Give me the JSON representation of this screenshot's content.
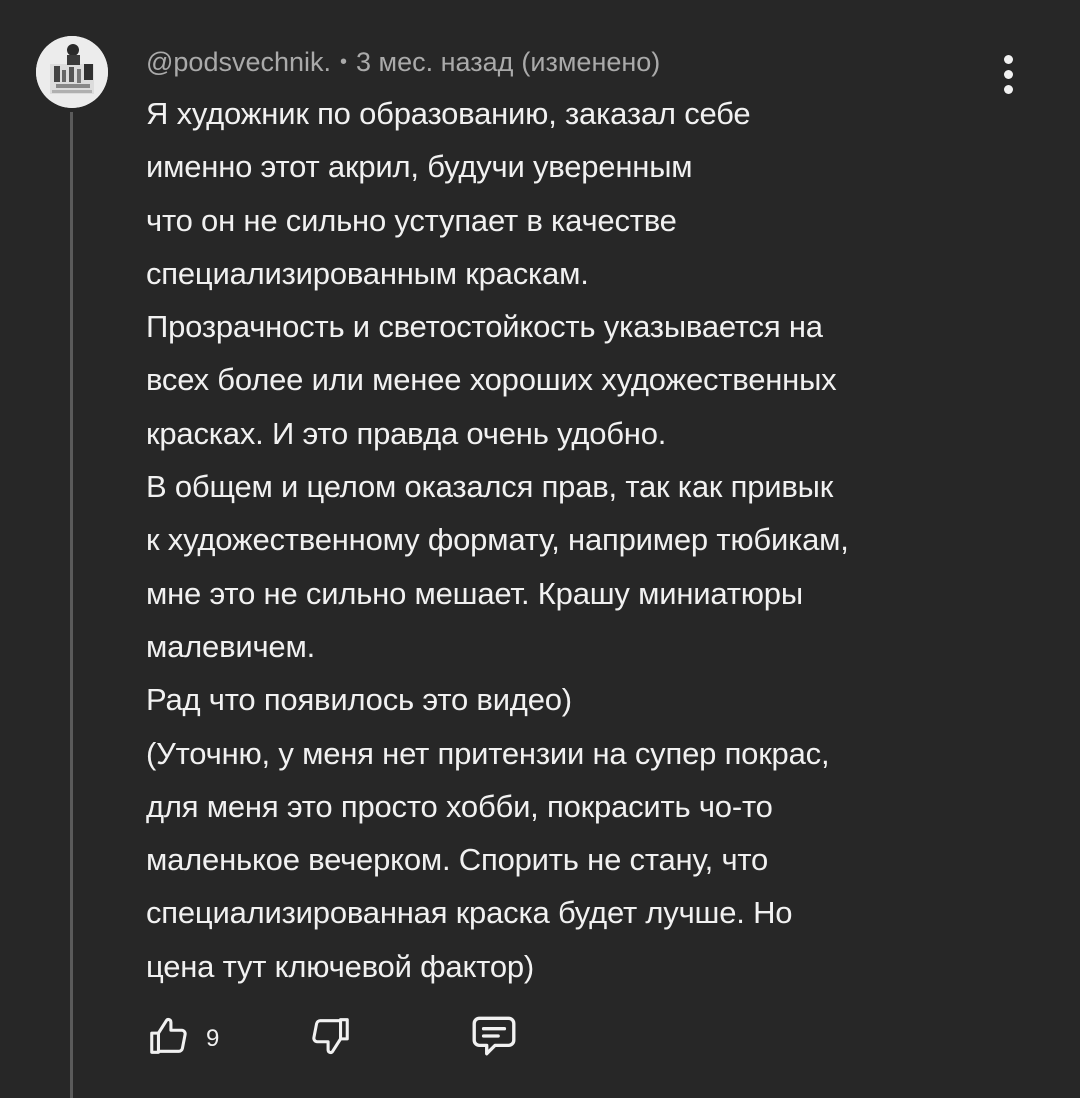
{
  "comment": {
    "author": "@podsvechnik.",
    "separator": "•",
    "time": "3 мес. назад",
    "edited": "(изменено)",
    "lines": [
      "Я художник по образованию, заказал себе",
      "именно этот акрил, будучи уверенным",
      "что он не сильно уступает в качестве",
      "специализированным краскам.",
      "Прозрачность и светостойкость указывается на",
      "всех более или менее хороших художественных",
      "красках. И это правда очень удобно.",
      "В общем и целом оказался прав, так как привык",
      "к художественному формату, например тюбикам,",
      "мне это не сильно мешает. Крашу миниатюры",
      "малевичем.",
      "Рад что появилось это видео)",
      "(Уточню, у меня нет притензии на супер покрас,",
      "для меня это просто хобби, покрасить чо-то",
      "маленькое вечерком. Спорить не стану, что",
      "специализированная краска будет лучше. Но",
      "цена тут ключевой фактор)"
    ],
    "like_count": "9"
  },
  "icons": {
    "menu": "more-vertical-icon",
    "like": "thumb-up-icon",
    "dislike": "thumb-down-icon",
    "reply": "reply-comment-icon"
  },
  "colors": {
    "background": "#272727",
    "text": "#f1f1f1",
    "secondary_text": "#aaaaaa",
    "thread_line": "#5a5a5a"
  }
}
